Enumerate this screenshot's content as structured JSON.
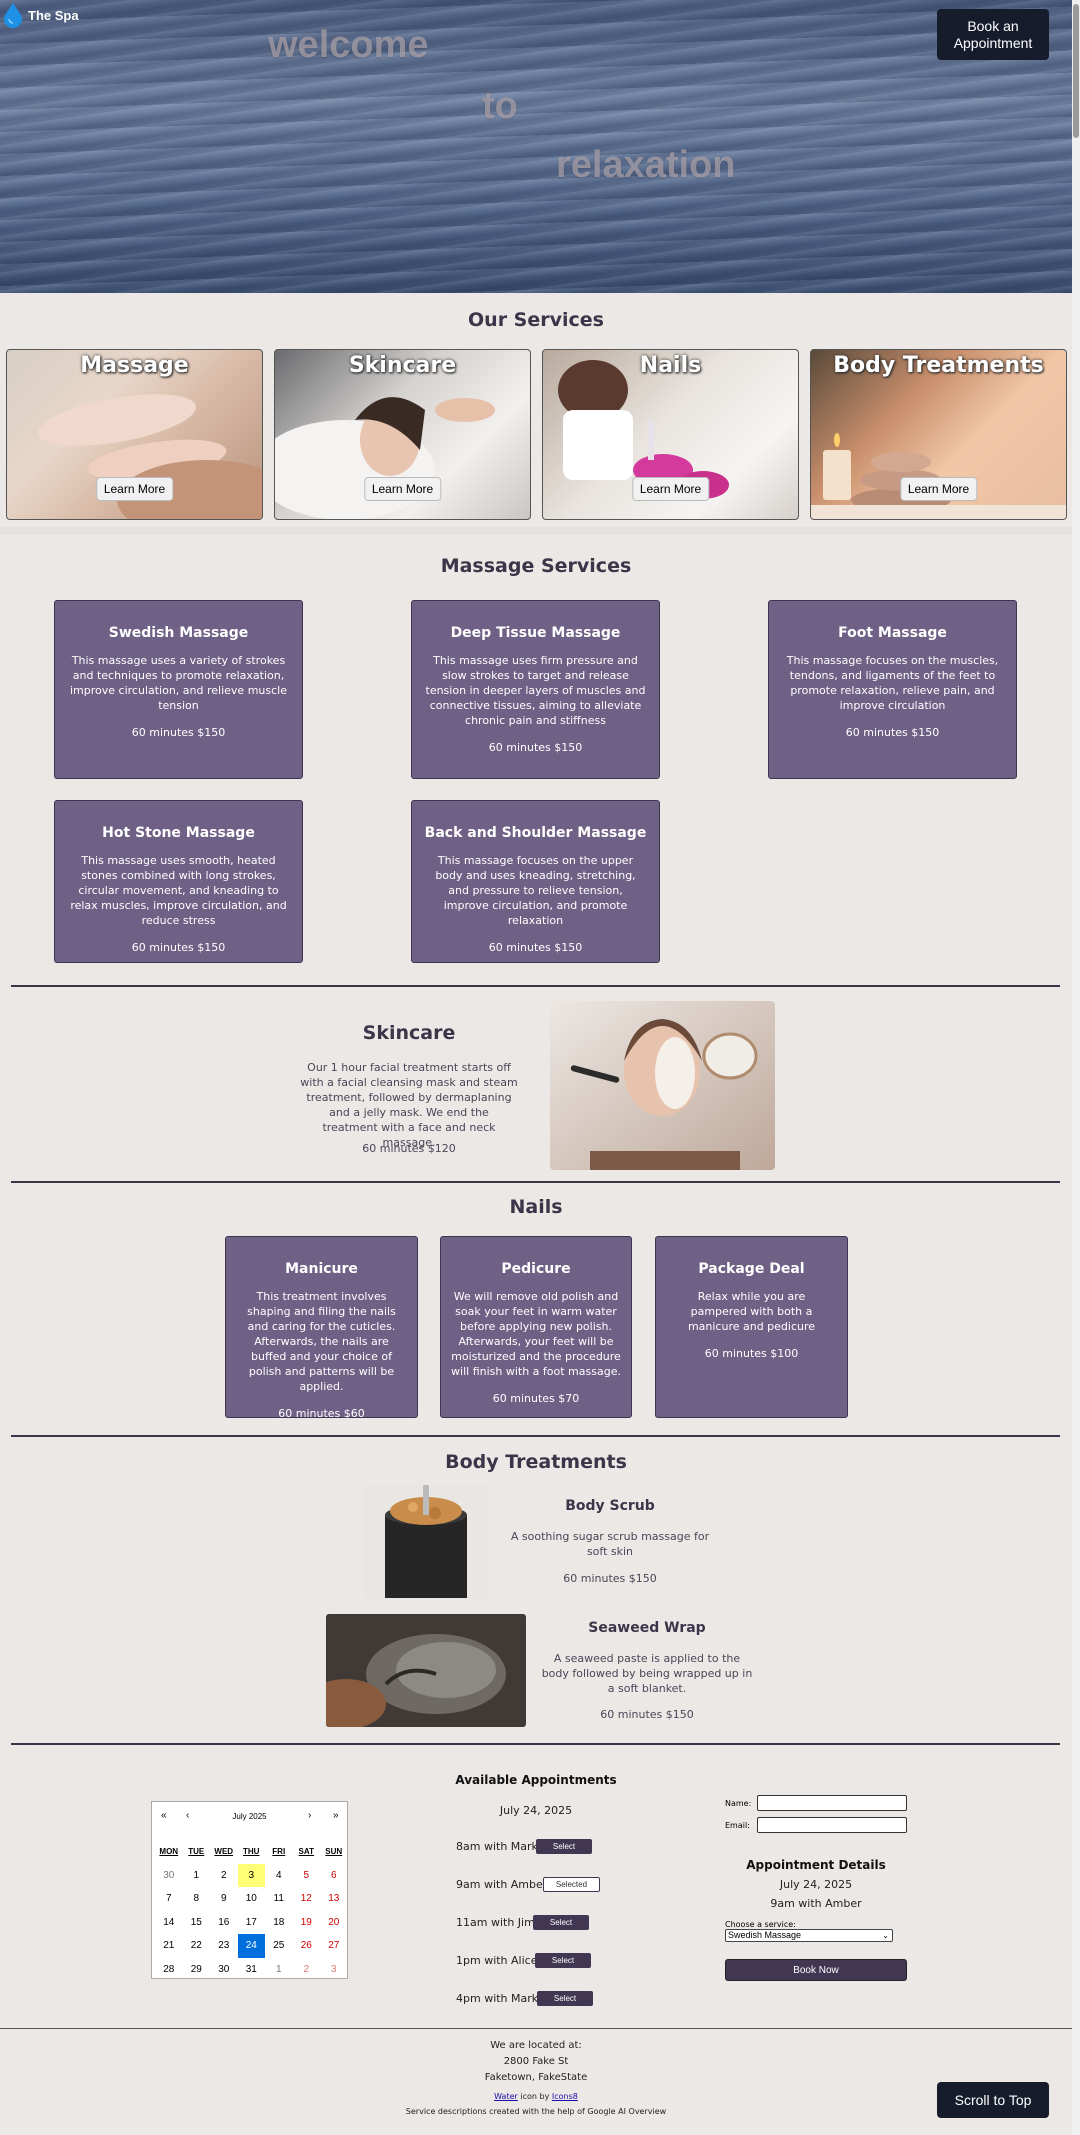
{
  "brand": {
    "name": "The Spa",
    "icon": "water-drop-icon"
  },
  "hero": {
    "words": [
      "welcome",
      "to",
      "relaxation"
    ]
  },
  "header": {
    "book_button": "Book an Appointment"
  },
  "services": {
    "title": "Our Services",
    "cards": [
      {
        "title": "Massage",
        "button": "Learn More"
      },
      {
        "title": "Skincare",
        "button": "Learn More"
      },
      {
        "title": "Nails",
        "button": "Learn More"
      },
      {
        "title": "Body Treatments",
        "button": "Learn More"
      }
    ]
  },
  "massage": {
    "title": "Massage Services",
    "cards": [
      {
        "name": "Swedish Massage",
        "desc": "This massage uses a variety of strokes and techniques to promote relaxation, improve circulation, and relieve muscle tension",
        "price": "60 minutes $150"
      },
      {
        "name": "Deep Tissue Massage",
        "desc": "This massage uses firm pressure and slow strokes to target and release tension in deeper layers of muscles and connective tissues, aiming to alleviate chronic pain and stiffness",
        "price": "60 minutes $150"
      },
      {
        "name": "Foot Massage",
        "desc": "This massage focuses on the muscles, tendons, and ligaments of the feet to promote relaxation, relieve pain, and improve circulation",
        "price": "60 minutes $150"
      },
      {
        "name": "Hot Stone Massage",
        "desc": "This massage uses smooth, heated stones combined with long strokes, circular movement, and kneading to relax muscles, improve circulation, and reduce stress",
        "price": "60 minutes $150"
      },
      {
        "name": "Back and Shoulder Massage",
        "desc": "This massage focuses on the upper body and uses kneading, stretching, and pressure to relieve tension, improve circulation, and promote relaxation",
        "price": "60 minutes $150"
      }
    ]
  },
  "skincare": {
    "title": "Skincare",
    "desc": "Our 1 hour facial treatment starts off with a facial cleansing mask and steam treatment, followed by dermaplaning and a jelly mask. We end the treatment with a face and neck massage.",
    "price": "60 minutes $120"
  },
  "nails": {
    "title": "Nails",
    "cards": [
      {
        "name": "Manicure",
        "desc": "This treatment involves shaping and filing the nails and caring for the cuticles. Afterwards, the nails are buffed and your choice of polish and patterns will be applied.",
        "price": "60 minutes $60"
      },
      {
        "name": "Pedicure",
        "desc": "We will remove old polish and soak your feet in warm water before applying new polish. Afterwards, your feet will be moisturized and the procedure will finish with a foot massage.",
        "price": "60 minutes $70"
      },
      {
        "name": "Package Deal",
        "desc": "Relax while you are pampered with both a manicure and pedicure",
        "price": "60 minutes $100"
      }
    ]
  },
  "body": {
    "title": "Body Treatments",
    "items": [
      {
        "name": "Body Scrub",
        "desc": "A soothing sugar scrub massage for soft skin",
        "price": "60 minutes $150"
      },
      {
        "name": "Seaweed Wrap",
        "desc": "A seaweed paste is applied to the body followed by being wrapped up in a soft blanket.",
        "price": "60 minutes $150"
      }
    ]
  },
  "calendar": {
    "month": "July 2025",
    "nav": {
      "prev_year": "«",
      "prev": "‹",
      "next": "›",
      "next_year": "»"
    },
    "weekdays": [
      "MON",
      "TUE",
      "WED",
      "THU",
      "FRI",
      "SAT",
      "SUN"
    ],
    "days": [
      "30",
      "1",
      "2",
      "3",
      "4",
      "5",
      "6",
      "7",
      "8",
      "9",
      "10",
      "11",
      "12",
      "13",
      "14",
      "15",
      "16",
      "17",
      "18",
      "19",
      "20",
      "21",
      "22",
      "23",
      "24",
      "25",
      "26",
      "27",
      "28",
      "29",
      "30",
      "31",
      "1",
      "2",
      "3"
    ],
    "today": "3",
    "selected": "24"
  },
  "appointments": {
    "title": "Available Appointments",
    "date": "July 24, 2025",
    "slots": [
      {
        "label": "8am with Mark",
        "button": "Select",
        "selected": false
      },
      {
        "label": "9am with Amber",
        "button": "Selected",
        "selected": true
      },
      {
        "label": "11am with Jim",
        "button": "Select",
        "selected": false
      },
      {
        "label": "1pm with Alice",
        "button": "Select",
        "selected": false
      },
      {
        "label": "4pm with Mark",
        "button": "Select",
        "selected": false
      }
    ]
  },
  "form": {
    "name_label": "Name:",
    "email_label": "Email:",
    "name_value": "",
    "email_value": "",
    "details_title": "Appointment Details",
    "details_date": "July 24, 2025",
    "details_slot": "9am with Amber",
    "service_label": "Choose a service:",
    "service_selected": "Swedish Massage",
    "book_button": "Book Now"
  },
  "footer": {
    "located": "We are located at:",
    "street": "2800 Fake St",
    "city": "Faketown, FakeState",
    "credit_link1": "Water",
    "credit_mid": " icon by ",
    "credit_link2": "Icons8",
    "credit2": "Service descriptions created with the help of Google AI Overview",
    "scroll_button": "Scroll to Top"
  },
  "colors": {
    "card": "#6f6186",
    "dark_button": "#161c2c",
    "heading": "#3d3449",
    "background": "#ece8e5",
    "selected_day": "#006edc",
    "today": "#ffff76"
  }
}
